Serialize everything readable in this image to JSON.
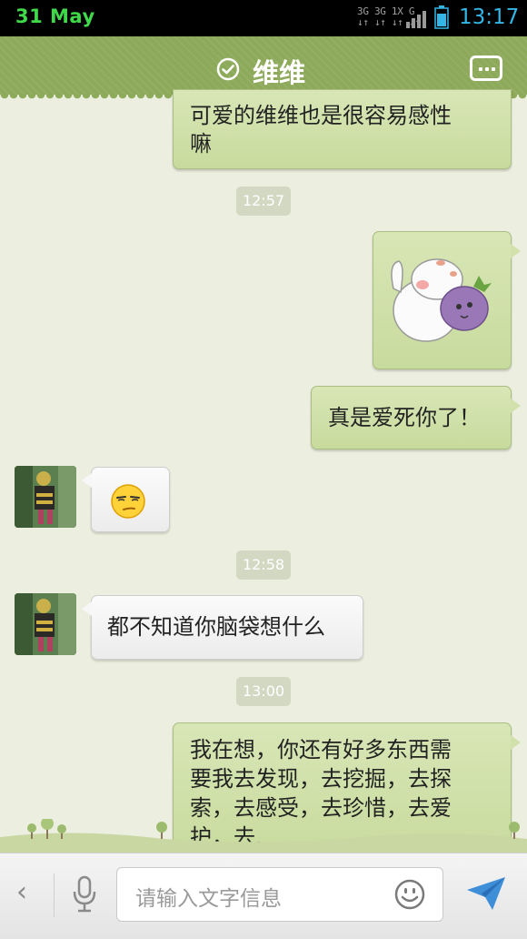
{
  "status_bar": {
    "date": "31 May",
    "network_top": "3G 3G 1X G",
    "network_bottom": "↓↑ ↓↑ ↓↑ ↓↑",
    "time": "13:17"
  },
  "header": {
    "title": "维维",
    "verified_icon": "check-circle-icon",
    "menu_icon": "more-icon"
  },
  "messages": [
    {
      "type": "text",
      "sender": "me",
      "text_line1": "可爱的维维也是很容易感性",
      "text_line2": "嘛"
    },
    {
      "type": "time",
      "text": "12:57"
    },
    {
      "type": "sticker",
      "sender": "me",
      "sticker": "cat-hugging-eggplant"
    },
    {
      "type": "text",
      "sender": "me",
      "text": "真是爱死你了！"
    },
    {
      "type": "emoji",
      "sender": "contact",
      "emoji": "smirk-face"
    },
    {
      "type": "time",
      "text": "12:58"
    },
    {
      "type": "text",
      "sender": "contact",
      "text": "都不知道你脑袋想什么"
    },
    {
      "type": "time",
      "text": "13:00"
    },
    {
      "type": "text",
      "sender": "me",
      "line1": "我在想，你还有好多东西需",
      "line2": "要我去发现，去挖掘，去探",
      "line3": "索，去感受，去珍惜，去爱",
      "line4": "护，去........"
    }
  ],
  "input_bar": {
    "placeholder": "请输入文字信息",
    "back_icon": "chevron-left-icon",
    "mic_icon": "mic-icon",
    "emoji_icon": "smiley-icon",
    "send_icon": "send-icon"
  },
  "colors": {
    "header": "#8da95a",
    "outgoing_bubble": "#d0e0a8",
    "background": "#ecefdf",
    "time_accent": "#33b5e5"
  }
}
